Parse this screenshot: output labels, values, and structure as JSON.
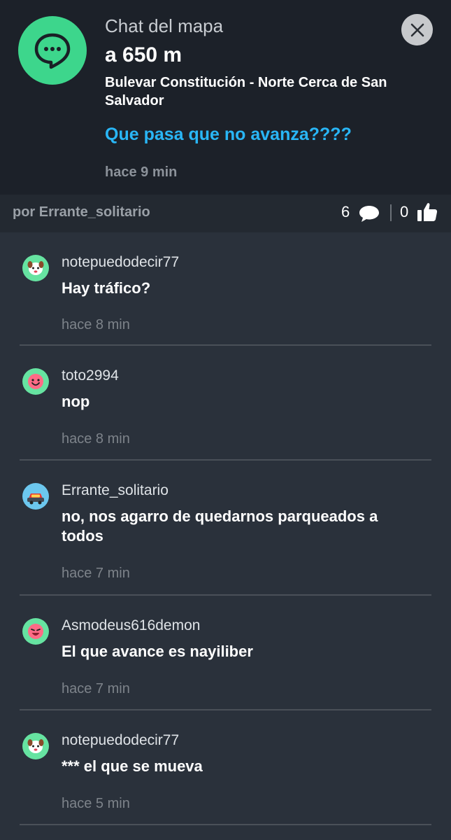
{
  "header": {
    "title": "Chat del mapa",
    "distance": "a 650 m",
    "street": "Bulevar Constitución - Norte Cerca de San Salvador",
    "question": "Que pasa que no avanza????",
    "time": "hace 9 min",
    "close_icon": "close-icon",
    "badge_icon": "chat-bubble-icon"
  },
  "meta": {
    "author": "por Errante_solitario",
    "comment_count": "6",
    "like_count": "0"
  },
  "messages": [
    {
      "user": "notepuedodecir77",
      "text": "Hay tráfico?",
      "time": "hace 8 min"
    },
    {
      "user": "toto2994",
      "text": "nop",
      "time": "hace 8 min"
    },
    {
      "user": "Errante_solitario",
      "text": "no, nos agarro de quedarnos parqueados a todos",
      "time": "hace 7 min"
    },
    {
      "user": "Asmodeus616demon",
      "text": "El que avance es nayiliber",
      "time": "hace 7 min"
    },
    {
      "user": "notepuedodecir77",
      "text": "*** el que se mueva",
      "time": "hace 5 min"
    }
  ],
  "colors": {
    "accent_green": "#3dd68c",
    "question_blue": "#29b6f6",
    "background": "#2a313b"
  }
}
